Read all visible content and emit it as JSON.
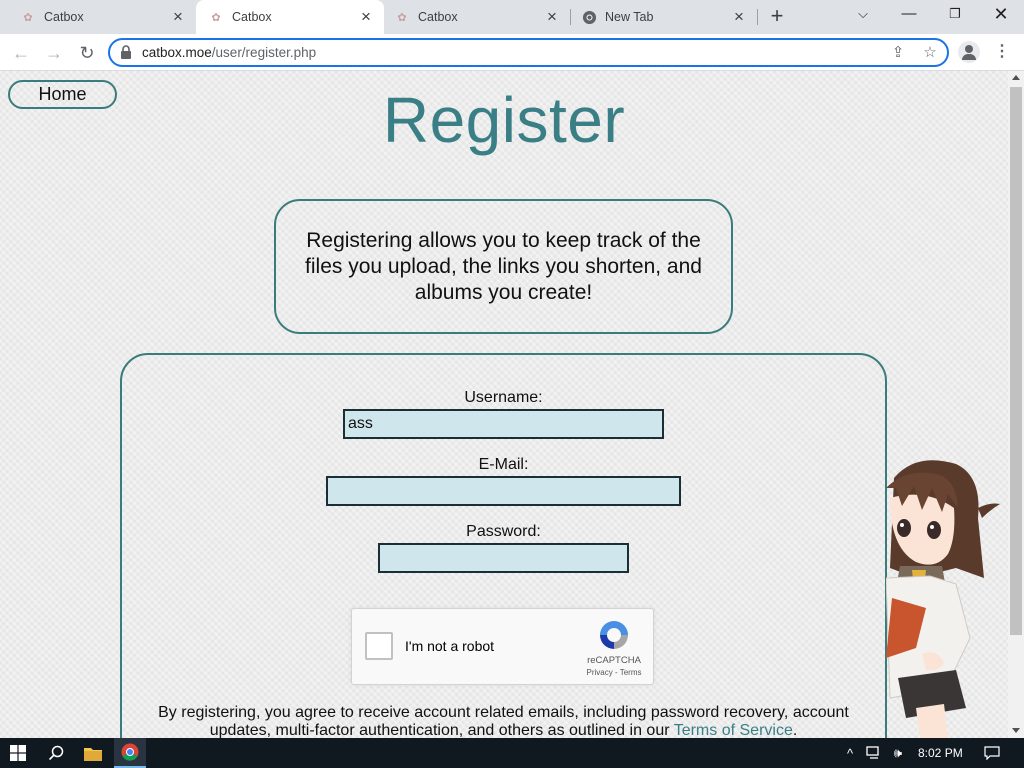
{
  "browser": {
    "tabs": [
      {
        "title": "Catbox",
        "active": false
      },
      {
        "title": "Catbox",
        "active": true
      },
      {
        "title": "Catbox",
        "active": false
      },
      {
        "title": "New Tab",
        "active": false
      }
    ],
    "url_host": "catbox.moe",
    "url_path": "/user/register.php"
  },
  "page": {
    "home_label": "Home",
    "title": "Register",
    "info_text": "Registering allows you to keep track of the files you upload, the links you shorten, and albums you create!",
    "form": {
      "username_label": "Username:",
      "username_value": "ass",
      "email_label": "E-Mail:",
      "email_value": "",
      "password_label": "Password:",
      "password_value": ""
    },
    "recaptcha": {
      "label": "I'm not a robot",
      "brand": "reCAPTCHA",
      "privacy": "Privacy",
      "separator": " - ",
      "terms": "Terms"
    },
    "terms_text": "By registering, you agree to receive account related emails, including password recovery, account updates, multi-factor authentication, and others as outlined in our ",
    "terms_link": "Terms of Service",
    "terms_end": "."
  },
  "taskbar": {
    "time": "8:02 PM"
  },
  "colors": {
    "accent_teal": "#3a7f86",
    "input_bg": "#cfe7ec",
    "omnibox_focus": "#1a73e8"
  }
}
